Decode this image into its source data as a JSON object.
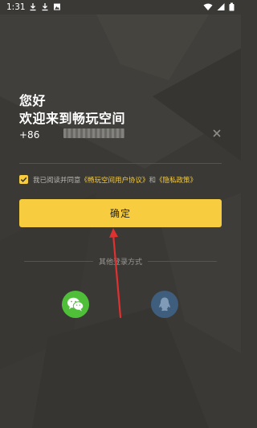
{
  "colors": {
    "background": "#3a3936",
    "accent": "#f7cc3f",
    "wechat": "#4fbf3a",
    "qq": "#3f5d7c",
    "annotation_arrow": "#e03131"
  },
  "status_bar": {
    "time": "1:31",
    "left_icons": [
      "download-icon",
      "download-icon",
      "screenshot-icon"
    ],
    "right_icons": [
      "wifi-icon",
      "signal-icon",
      "battery-icon"
    ]
  },
  "greeting": {
    "line1": "您好",
    "line2": "欢迎来到畅玩空间"
  },
  "phone": {
    "country_code": "+86",
    "value_masked": true,
    "clear_icon": "close-icon"
  },
  "agreement": {
    "checked": true,
    "prefix": "我已阅读并同意",
    "user_agreement": "《畅玩空间用户协议》",
    "conjunction": "和",
    "privacy_policy": "《隐私政策》"
  },
  "confirm_label": "确定",
  "other_login": {
    "label": "其他登录方式",
    "options": [
      "wechat-icon",
      "qq-icon"
    ]
  }
}
